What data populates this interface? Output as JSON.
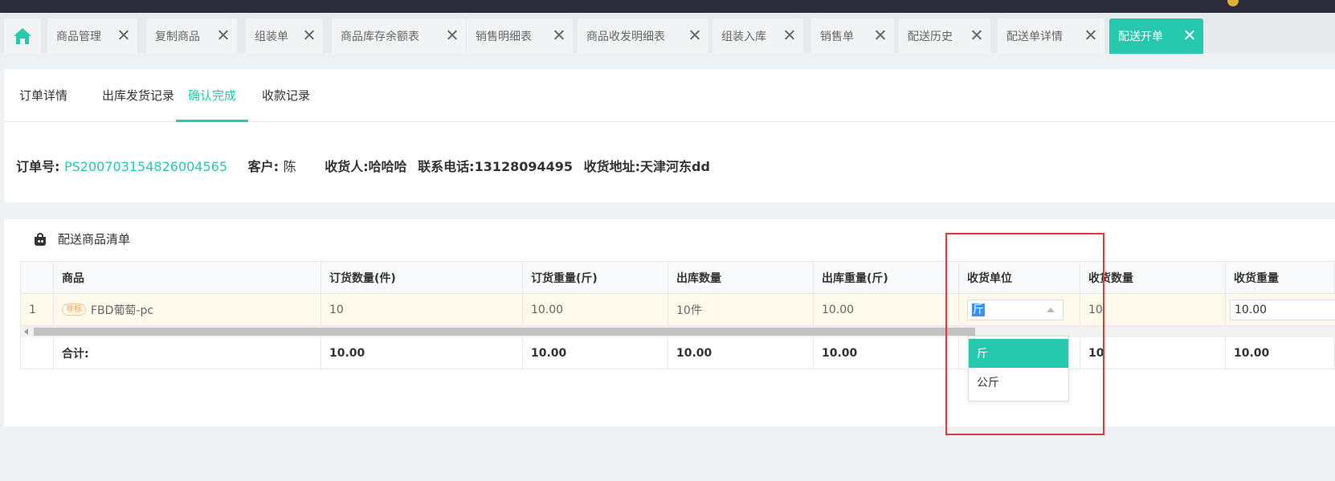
{
  "colors": {
    "accent": "#26c9ae",
    "highlight_box": "#e53935",
    "topbar": "#2b2e3a"
  },
  "tabs": [
    {
      "label": "",
      "icon": "home-icon"
    },
    {
      "label": "商品管理"
    },
    {
      "label": "复制商品"
    },
    {
      "label": "组装单"
    },
    {
      "label": "商品库存余额表"
    },
    {
      "label": "销售明细表"
    },
    {
      "label": "商品收发明细表"
    },
    {
      "label": "组装入库"
    },
    {
      "label": "销售单"
    },
    {
      "label": "配送历史"
    },
    {
      "label": "配送单详情"
    },
    {
      "label": "配送开单",
      "active": true
    }
  ],
  "subtabs": [
    {
      "label": "订单详情"
    },
    {
      "label": "出库发货记录"
    },
    {
      "label": "确认完成",
      "active": true
    },
    {
      "label": "收款记录"
    }
  ],
  "order": {
    "id_label": "订单号:",
    "id": "PS200703154826004565",
    "customer_label": "客户:",
    "customer": "陈",
    "receiver": "收货人:哈哈哈",
    "phone": "联系电话:13128094495",
    "address": "收货地址:天津河东dd"
  },
  "section": {
    "title": "配送商品清单",
    "icon": "shopping-bag-icon"
  },
  "table": {
    "headers": [
      "",
      "商品",
      "订货数量(件)",
      "订货重量(斤)",
      "出库数量",
      "出库重量(斤)",
      "收货单位",
      "收货数量",
      "收货重量"
    ],
    "row": {
      "index": "1",
      "tag": "非标",
      "product": "FBD葡萄-pc",
      "order_qty": "10",
      "order_weight": "10.00",
      "out_qty": "10件",
      "out_weight": "10.00",
      "unit": "斤",
      "recv_qty": "10",
      "recv_weight": "10.00"
    },
    "total": {
      "label": "合计:",
      "order_qty": "10.00",
      "order_weight": "10.00",
      "out_qty": "10.00",
      "out_weight": "10.00",
      "recv_qty": "10",
      "recv_weight": "10.00"
    }
  },
  "unit_dropdown": {
    "options": [
      "斤",
      "公斤"
    ],
    "selected": "斤"
  }
}
